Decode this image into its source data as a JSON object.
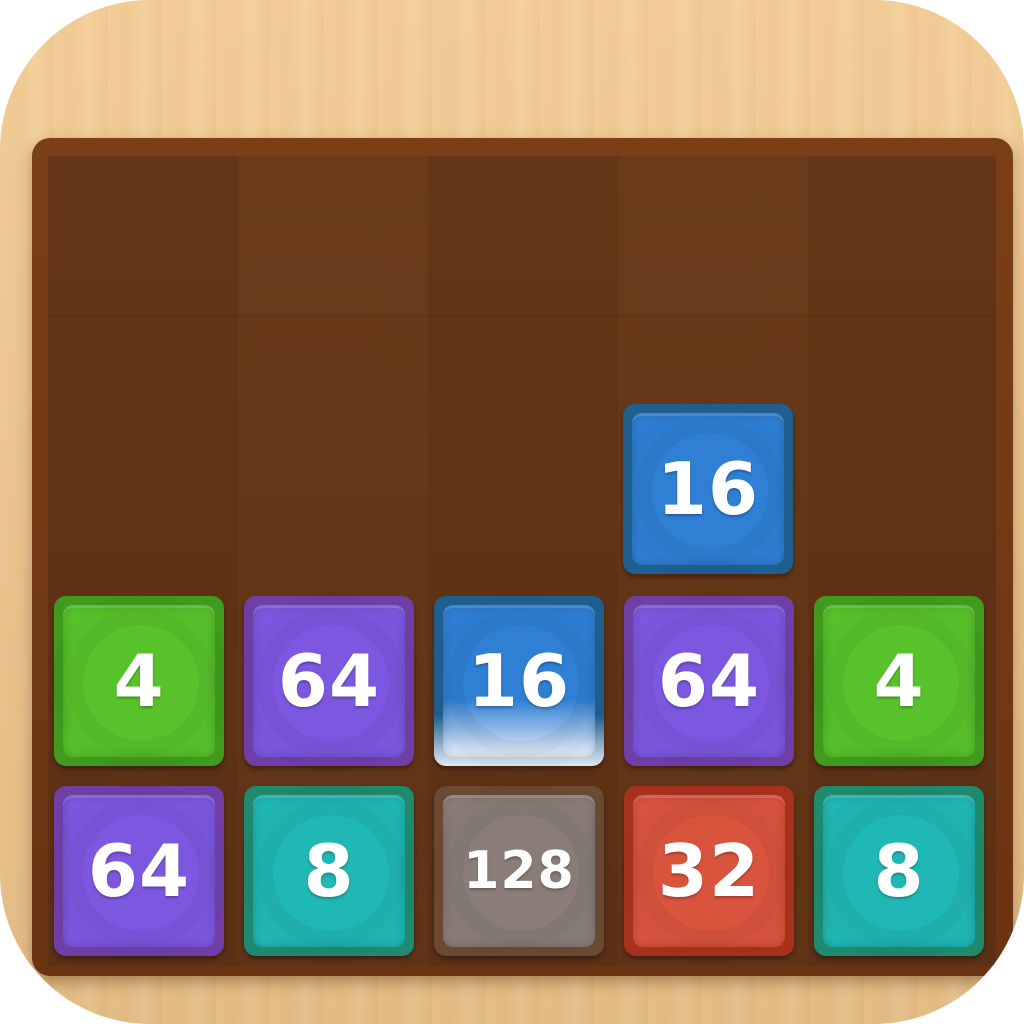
{
  "game": {
    "board": {
      "columns": 5,
      "rows": 4
    },
    "tiles": {
      "top_col4": {
        "value": "16",
        "color": "#2f7fd4"
      },
      "r3c1": {
        "value": "4",
        "color": "#58c22b"
      },
      "r3c2": {
        "value": "64",
        "color": "#7c58e0"
      },
      "r3c3": {
        "value": "16",
        "color": "#2f7fd4",
        "state": "merging"
      },
      "r3c4": {
        "value": "64",
        "color": "#7c58e0"
      },
      "r3c5": {
        "value": "4",
        "color": "#58c22b"
      },
      "r4c1": {
        "value": "64",
        "color": "#7c58e0"
      },
      "r4c2": {
        "value": "8",
        "color": "#20b8b4"
      },
      "r4c3": {
        "value": "128",
        "color": "#8a7d78"
      },
      "r4c4": {
        "value": "32",
        "color": "#d9543d"
      },
      "r4c5": {
        "value": "8",
        "color": "#20b8b4"
      }
    },
    "colors": {
      "frame_wood": "#efc68c",
      "board_rim": "#6a3312",
      "board_background": "#5d3216"
    }
  }
}
